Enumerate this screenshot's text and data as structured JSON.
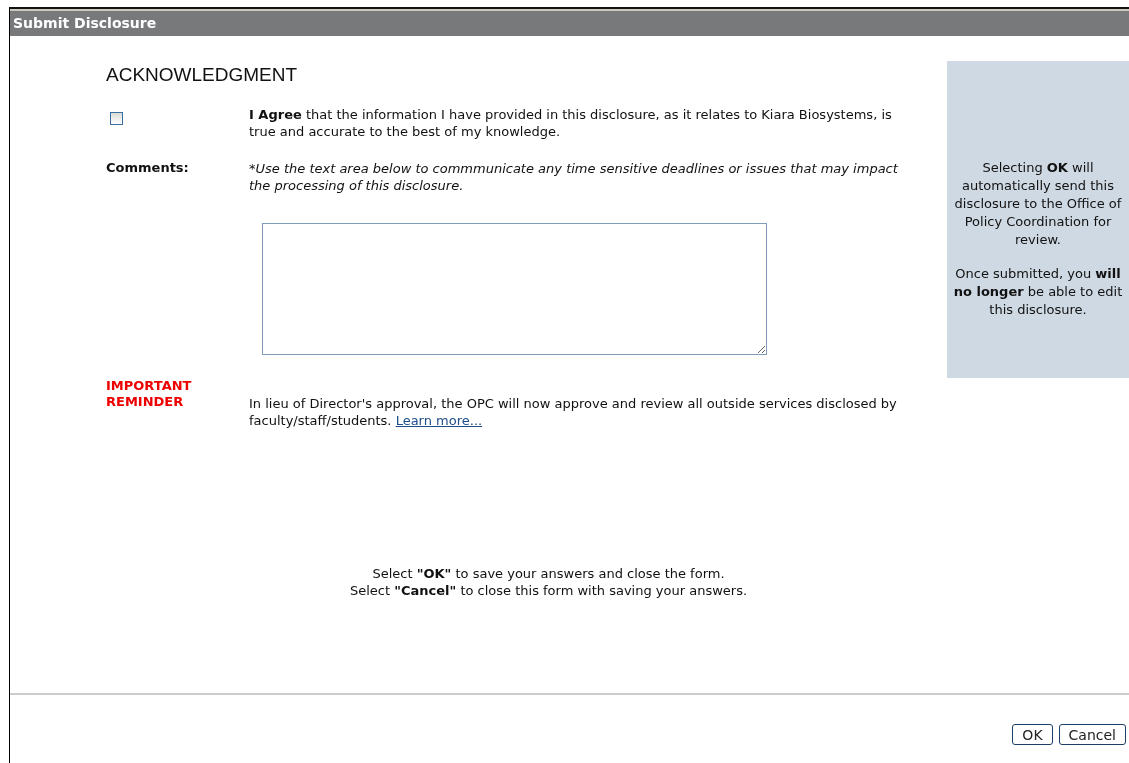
{
  "window": {
    "title": "Submit Disclosure"
  },
  "heading": "ACKNOWLEDGMENT",
  "agree": {
    "checked": false,
    "text": "**I Agree** that the information I have provided in this disclosure, as it relates to Kiara Biosystems, is true and accurate to the best of my knowledge."
  },
  "comments": {
    "label": "Comments:",
    "hint": "*Use the text area below to commmunicate any time sensitive deadlines or issues that may impact the processing of this disclosure."
  },
  "reminder": {
    "label": "IMPORTANT REMINDER",
    "text": "In lieu of Director's approval, the OPC will now approve and review all outside services disclosed by faculty/staff/students.",
    "link": "Learn more..."
  },
  "instructions": [
    "Select **\"OK\"** to save your answers and close the form.",
    "Select **\"Cancel\"** to close this form with saving your answers."
  ],
  "side_panel": [
    "Selecting **OK** will automatically send this disclosure to the Office of Policy Coordination for review.",
    "Once submitted, you **will no longer** be able to edit this disclosure."
  ],
  "buttons": [
    "OK",
    "Cancel"
  ]
}
